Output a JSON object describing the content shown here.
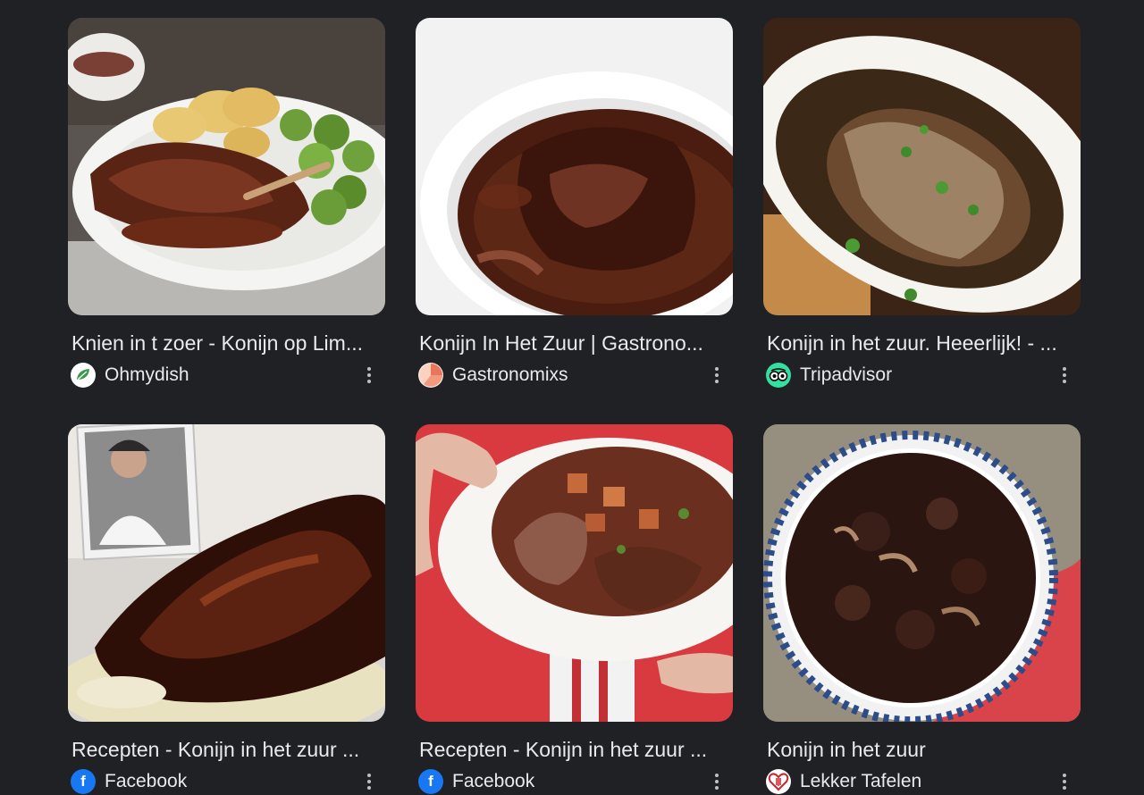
{
  "results": [
    {
      "title": "Knien in t zoer - Konijn op Lim...",
      "source": "Ohmydish",
      "favicon": "leaf-icon",
      "favicon_color": "#ffffff"
    },
    {
      "title": "Konijn In Het Zuur | Gastrono...",
      "source": "Gastronomixs",
      "favicon": "slice-icon",
      "favicon_color": "#e8765a"
    },
    {
      "title": "Konijn in het zuur. Heeerlijk! - ...",
      "source": "Tripadvisor",
      "favicon": "owl-icon",
      "favicon_color": "#34e0a1"
    },
    {
      "title": "Recepten - Konijn in het zuur ...",
      "source": "Facebook",
      "favicon": "facebook-icon",
      "favicon_color": "#1877f2"
    },
    {
      "title": "Recepten - Konijn in het zuur ...",
      "source": "Facebook",
      "favicon": "facebook-icon",
      "favicon_color": "#1877f2"
    },
    {
      "title": "Konijn in het zuur",
      "source": "Lekker Tafelen",
      "favicon": "heart-logo-icon",
      "favicon_color": "#ffffff"
    }
  ]
}
